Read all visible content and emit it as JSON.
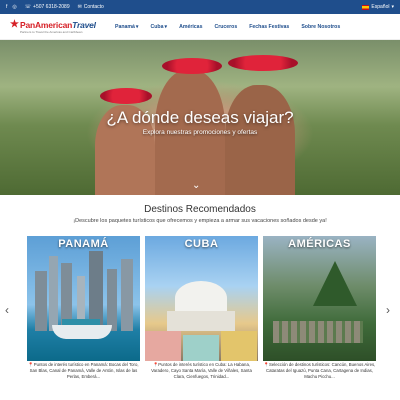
{
  "topbar": {
    "social": [
      "f",
      "◎"
    ],
    "phone": "+507 6318-2089",
    "contact": "Contacto",
    "language": "Español"
  },
  "logo": {
    "brand_part1": "PanAmerican",
    "brand_part2": "Travel",
    "tagline": "Partners to Travel the Americas and Caribbean"
  },
  "menu": {
    "items": [
      "Panamá",
      "Cuba",
      "Américas",
      "Cruceros",
      "Fechas Festivas",
      "Sobre Nosotros"
    ]
  },
  "hero": {
    "title": "¿A dónde deseas viajar?",
    "subtitle": "Explora nuestras promociones y ofertas"
  },
  "section": {
    "title": "Destinos Recomendados",
    "subtitle": "¡Descubre los paquetes turísticos que ofrecemos y empieza a armar sus vacaciones soñados desde ya!"
  },
  "cards": [
    {
      "label": "PANAMÁ",
      "desc": "📍Puntos de interés turístico en Panamá: Bocas del Toro, San Blas, Canal de Panamá, Valle de Antón, Islas de las Perlas, Emberá..."
    },
    {
      "label": "CUBA",
      "desc": "📍Puntos de interés turístico en Cuba: La Habana, Varadero, Cayo Santa María, Valle de Viñales, Santa Clara, Cienfuegos, Trinidad..."
    },
    {
      "label": "AMÉRICAS",
      "desc": "📍Selección de destinos turísticos: Cancún, Buenos Aires, Cataratas del Iguazú, Punta Cana, Cartagena de Indias, Machu Picchu..."
    }
  ],
  "colors": {
    "brand_blue": "#1f4e8c",
    "brand_red": "#d61f26"
  }
}
